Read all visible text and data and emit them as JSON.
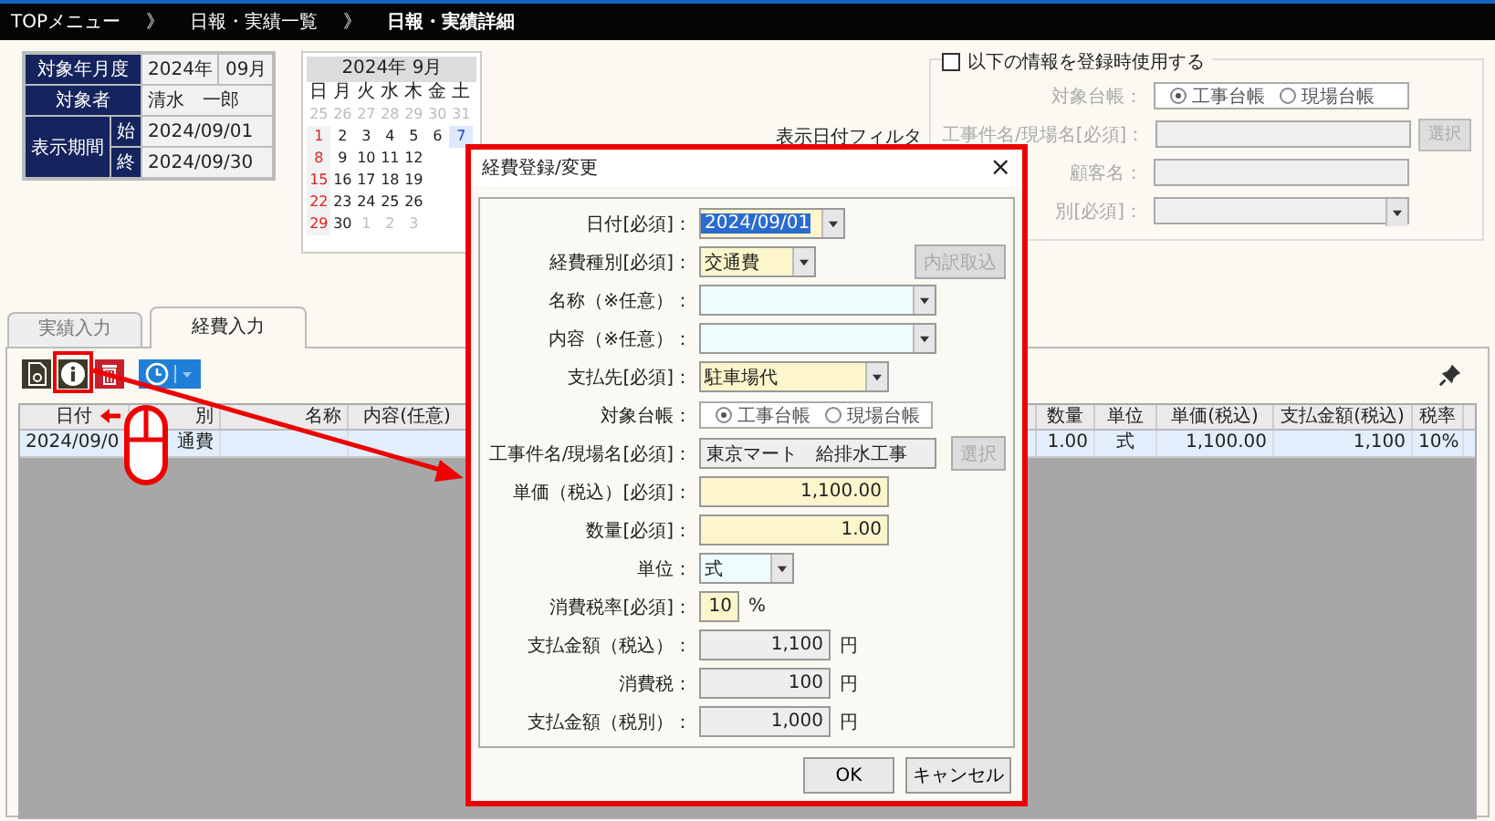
{
  "breadcrumbs": [
    {
      "label": "TOPメニュー",
      "current": false,
      "separator": "》"
    },
    {
      "label": "日報・実績一覧",
      "current": false,
      "separator": "》"
    },
    {
      "label": "日報・実績詳細",
      "current": true
    }
  ],
  "info": {
    "year_label": "対象年月度",
    "year": "2024年",
    "month": "09月",
    "person_label": "対象者",
    "person": "清水　一郎",
    "period_label": "表示期間",
    "start_label": "始",
    "start": "2024/09/01",
    "end_label": "終",
    "end": "2024/09/30"
  },
  "calendar": {
    "title": "2024年 9月",
    "weekdays": [
      "日",
      "月",
      "火",
      "水",
      "木",
      "金",
      "土"
    ],
    "weeks": [
      [
        {
          "day": "25",
          "muted": true
        },
        {
          "day": "26",
          "muted": true
        },
        {
          "day": "27",
          "muted": true
        },
        {
          "day": "28",
          "muted": true
        },
        {
          "day": "29",
          "muted": true
        },
        {
          "day": "30",
          "muted": true
        },
        {
          "day": "31",
          "muted": true
        }
      ],
      [
        {
          "day": "1",
          "muted": false
        },
        {
          "day": "2",
          "muted": false
        },
        {
          "day": "3",
          "muted": false
        },
        {
          "day": "4",
          "muted": false
        },
        {
          "day": "5",
          "muted": false
        },
        {
          "day": "6",
          "muted": false
        },
        {
          "day": "7",
          "muted": false
        }
      ],
      [
        {
          "day": "8",
          "muted": false
        },
        {
          "day": "9",
          "muted": false
        },
        {
          "day": "10",
          "muted": false
        },
        {
          "day": "11",
          "muted": false
        },
        {
          "day": "12",
          "muted": false
        }
      ],
      [
        {
          "day": "15",
          "muted": false
        },
        {
          "day": "16",
          "muted": false
        },
        {
          "day": "17",
          "muted": false
        },
        {
          "day": "18",
          "muted": false
        },
        {
          "day": "19",
          "muted": false
        }
      ],
      [
        {
          "day": "22",
          "muted": false
        },
        {
          "day": "23",
          "muted": false
        },
        {
          "day": "24",
          "muted": false
        },
        {
          "day": "25",
          "muted": false
        },
        {
          "day": "26",
          "muted": false
        }
      ],
      [
        {
          "day": "29",
          "muted": false
        },
        {
          "day": "30",
          "muted": false
        },
        {
          "day": "1",
          "muted": true
        },
        {
          "day": "2",
          "muted": true
        },
        {
          "day": "3",
          "muted": true
        }
      ]
    ]
  },
  "filter_label": "表示日付フィルタ",
  "register_panel": {
    "checkbox": {
      "label": "以下の情報を登録時使用する",
      "checked": false
    },
    "disabled": true,
    "ledger": {
      "label": "対象台帳：",
      "options": [
        {
          "label": "工事台帳",
          "selected": true
        },
        {
          "label": "現場台帳",
          "selected": false
        }
      ]
    },
    "site": {
      "label": "工事件名/現場名[必須]：",
      "button": "選択"
    },
    "customer": {
      "label": "顧客名："
    },
    "category": {
      "label": "別[必須]："
    }
  },
  "tabs": [
    {
      "label": "実績入力",
      "selected": false
    },
    {
      "label": "経費入力",
      "selected": true
    }
  ],
  "table": {
    "columns": [
      "日付",
      "別",
      "名称",
      "内容(任意)",
      "数量",
      "単位",
      "単価(税込)",
      "支払金額(税込)",
      "税率"
    ],
    "rows": [
      {
        "selected": true,
        "cells": [
          "2024/09/0",
          "通費",
          null,
          null,
          "1.00",
          "式",
          "1,100.00",
          "1,100",
          "10%"
        ]
      }
    ]
  },
  "dialog": {
    "title": "経費登録/変更",
    "close": "×",
    "fields": [
      {
        "label": "日付[必須]：",
        "kind": "combo",
        "value": "2024/09/01",
        "required": true,
        "text_selected": true
      },
      {
        "label": "経費種別[必須]：",
        "kind": "combo",
        "value": "交通費",
        "required": true,
        "button": {
          "label": "内訳取込",
          "disabled": true
        }
      },
      {
        "label": "名称（※任意）：",
        "kind": "combo",
        "required": false
      },
      {
        "label": "内容（※任意）：",
        "kind": "combo",
        "required": false
      },
      {
        "label": "支払先[必須]：",
        "kind": "combo",
        "value": "駐車場代",
        "required": true
      },
      {
        "label": "対象台帳：",
        "kind": "radio",
        "options": [
          {
            "label": "工事台帳",
            "selected": true
          },
          {
            "label": "現場台帳",
            "selected": false
          }
        ]
      },
      {
        "label": "工事件名/現場名[必須]：",
        "kind": "display",
        "value": "東京マート　給排水工事",
        "button": {
          "label": "選択",
          "disabled": true
        }
      },
      {
        "label": "単価（税込）[必須]：",
        "kind": "number",
        "value": "1,100.00",
        "required": true
      },
      {
        "label": "数量[必須]：",
        "kind": "number",
        "value": "1.00",
        "required": true
      },
      {
        "label": "単位：",
        "kind": "combo",
        "value": "式",
        "required": false
      },
      {
        "label": "消費税率[必須]：",
        "kind": "number",
        "value": "10",
        "required": true,
        "unit": "%"
      },
      {
        "label": "支払金額（税込）：",
        "kind": "readonly",
        "value": "1,100",
        "unit": "円"
      },
      {
        "label": "消費税：",
        "kind": "readonly",
        "value": "100",
        "unit": "円"
      },
      {
        "label": "支払金額（税別）：",
        "kind": "readonly",
        "value": "1,000",
        "unit": "円"
      }
    ],
    "buttons": [
      {
        "label": "OK"
      },
      {
        "label": "キャンセル"
      }
    ]
  }
}
